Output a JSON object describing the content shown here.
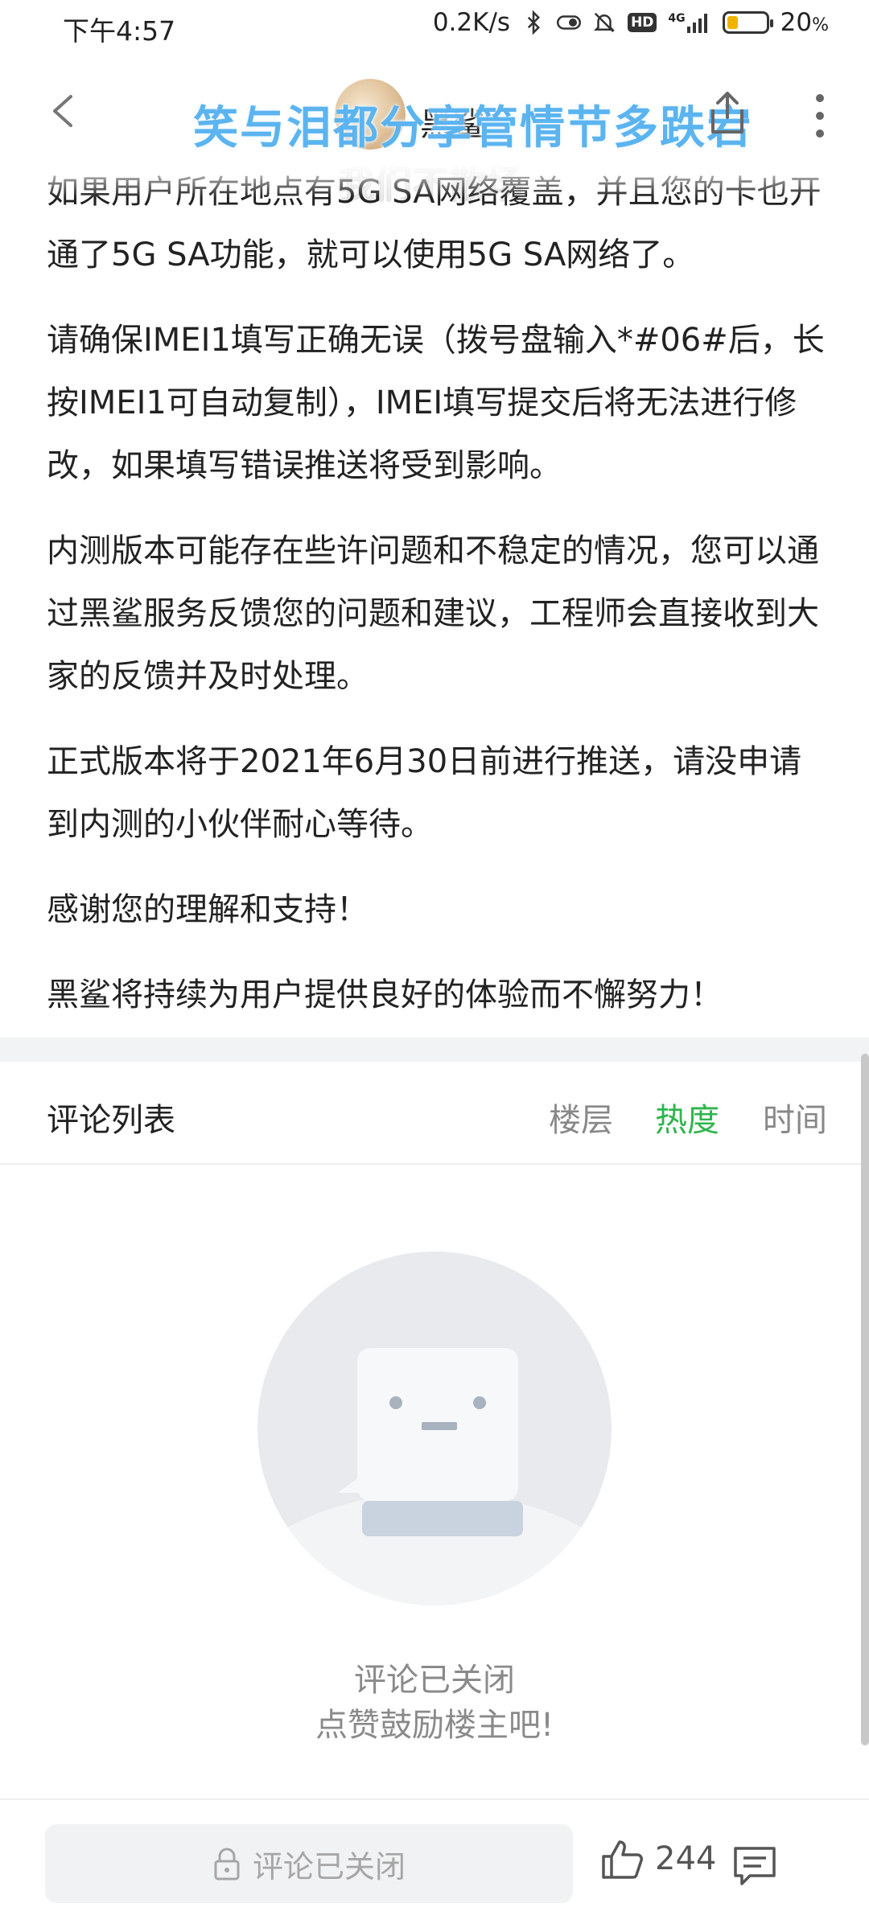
{
  "status_bar": {
    "time": "下午4:57",
    "net_speed": "0.2K/s",
    "hd": "HD",
    "network": "4G",
    "battery": "20",
    "battery_unit": "%",
    "battery_level": 0.2
  },
  "nav": {
    "author_name": "黑鲨",
    "overlay_title": "笑与泪都分享管情节多跌宕",
    "overlay_sub": "我们不散场"
  },
  "article": {
    "paragraphs": [
      "如果用户所在地点有5G SA网络覆盖，并且您的卡也开通了5G SA功能，就可以使用5G SA网络了。",
      "请确保IMEI1填写正确无误（拨号盘输入*#06#后，长按IMEI1可自动复制），IMEI填写提交后将无法进行修改，如果填写错误推送将受到影响。",
      "内测版本可能存在些许问题和不稳定的情况，您可以通过黑鲨服务反馈您的问题和建议，工程师会直接收到大家的反馈并及时处理。",
      "正式版本将于2021年6月30日前进行推送，请没申请到内测的小伙伴耐心等待。",
      "感谢您的理解和支持！",
      "黑鲨将持续为用户提供良好的体验而不懈努力！"
    ]
  },
  "comments": {
    "title": "评论列表",
    "sort_options": [
      "楼层",
      "热度",
      "时间"
    ],
    "active_sort": "热度",
    "empty_line1": "评论已关闭",
    "empty_line2": "点赞鼓励楼主吧!"
  },
  "bottom_bar": {
    "input_placeholder": "评论已关闭",
    "like_count": "244"
  },
  "colors": {
    "accent_green": "#2db54b",
    "battery_yellow": "#f0b400",
    "overlay_blue": "#5bb4f0"
  }
}
